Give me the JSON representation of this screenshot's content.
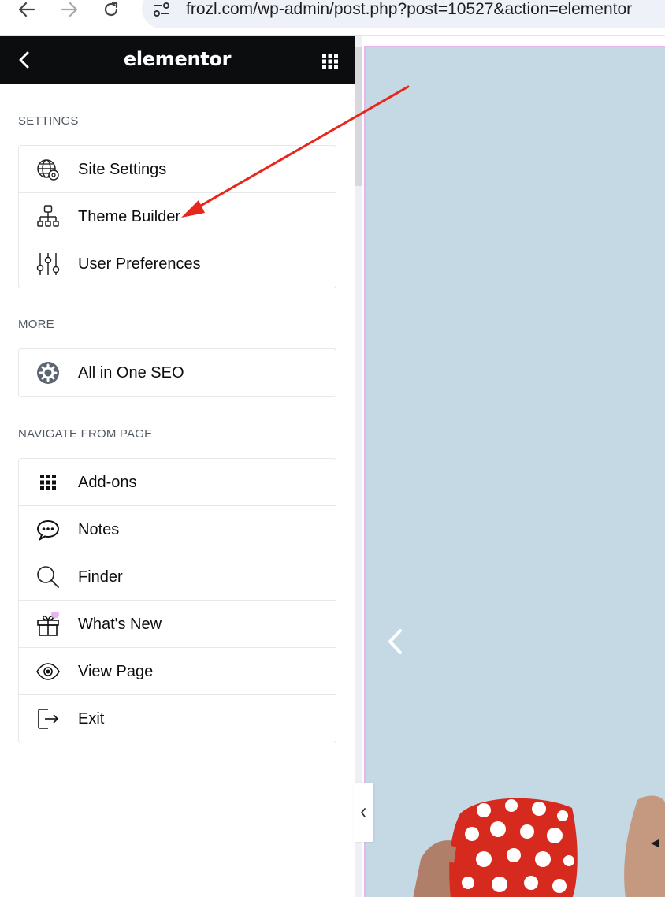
{
  "browser": {
    "url": "frozl.com/wp-admin/post.php?post=10527&action=elementor"
  },
  "header": {
    "logo": "elementor"
  },
  "sections": [
    {
      "title": "SETTINGS",
      "items": [
        {
          "label": "Site Settings",
          "icon": "globe-settings-icon"
        },
        {
          "label": "Theme Builder",
          "icon": "sitemap-icon"
        },
        {
          "label": "User Preferences",
          "icon": "sliders-icon"
        }
      ]
    },
    {
      "title": "MORE",
      "items": [
        {
          "label": "All in One SEO",
          "icon": "aioseo-gear-icon"
        }
      ]
    },
    {
      "title": "NAVIGATE FROM PAGE",
      "items": [
        {
          "label": "Add-ons",
          "icon": "apps-grid-icon"
        },
        {
          "label": "Notes",
          "icon": "comment-icon"
        },
        {
          "label": "Finder",
          "icon": "search-icon"
        },
        {
          "label": "What's New",
          "icon": "gift-icon"
        },
        {
          "label": "View Page",
          "icon": "eye-icon"
        },
        {
          "label": "Exit",
          "icon": "exit-icon"
        }
      ]
    }
  ],
  "colors": {
    "header_bg": "#0c0d0e",
    "canvas_bg": "#c4d9e4",
    "annotation_arrow": "#e8261c",
    "notification_dot": "#e8b4f0"
  }
}
